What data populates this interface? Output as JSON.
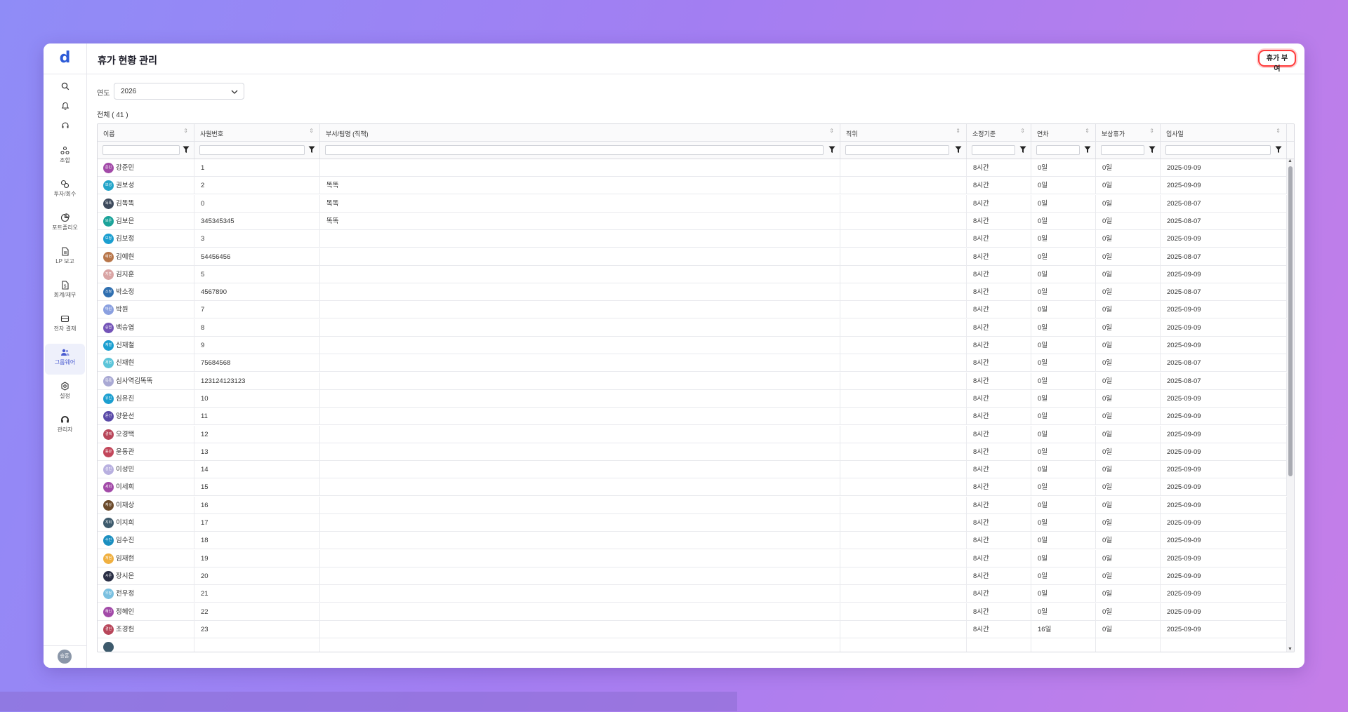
{
  "app": {
    "logo_text": "d"
  },
  "sidebar": {
    "icons": [
      "search-icon",
      "bell-icon",
      "headset-icon"
    ],
    "items": [
      {
        "label": "조합",
        "icon": "union-icon"
      },
      {
        "label": "투자/회수",
        "icon": "investment-icon"
      },
      {
        "label": "포트폴리오",
        "icon": "portfolio-icon"
      },
      {
        "label": "LP 보고",
        "icon": "report-icon"
      },
      {
        "label": "회계/재무",
        "icon": "accounting-icon"
      },
      {
        "label": "전자 결재",
        "icon": "approval-icon"
      },
      {
        "label": "그룹웨어",
        "icon": "groupware-icon",
        "active": true
      },
      {
        "label": "설정",
        "icon": "settings-icon"
      },
      {
        "label": "관리자",
        "icon": "admin-icon"
      }
    ],
    "user_avatar": "승훈"
  },
  "header": {
    "title": "휴가 현황 관리",
    "grant_button": "휴가 부여"
  },
  "filters": {
    "year_label": "연도",
    "year_value": "2026"
  },
  "total": "전체 ( 41 )",
  "table": {
    "columns": [
      "이름",
      "사원번호",
      "부서/팀명 (직책)",
      "직위",
      "소정기준",
      "연차",
      "보상휴가",
      "입사일"
    ],
    "rows": [
      {
        "name": "강준민",
        "avatar": "준민",
        "color": "#a24aa8",
        "no": "1",
        "dept": "",
        "pos": "",
        "base": "8시간",
        "annual": "0일",
        "comp": "0일",
        "join": "2025-09-09"
      },
      {
        "name": "권보성",
        "avatar": "보성",
        "color": "#23a5c9",
        "no": "2",
        "dept": "똑똑",
        "pos": "",
        "base": "8시간",
        "annual": "0일",
        "comp": "0일",
        "join": "2025-09-09"
      },
      {
        "name": "김똑똑",
        "avatar": "똑똑",
        "color": "#3d4a5c",
        "no": "0",
        "dept": "똑똑",
        "pos": "",
        "base": "8시간",
        "annual": "0일",
        "comp": "0일",
        "join": "2025-08-07"
      },
      {
        "name": "김보은",
        "avatar": "보은",
        "color": "#1ba39a",
        "no": "345345345",
        "dept": "똑똑",
        "pos": "",
        "base": "8시간",
        "annual": "0일",
        "comp": "0일",
        "join": "2025-08-07"
      },
      {
        "name": "김보정",
        "avatar": "보정",
        "color": "#1b9fd0",
        "no": "3",
        "dept": "",
        "pos": "",
        "base": "8시간",
        "annual": "0일",
        "comp": "0일",
        "join": "2025-09-09"
      },
      {
        "name": "김예현",
        "avatar": "예현",
        "color": "#b8764a",
        "no": "54456456",
        "dept": "",
        "pos": "",
        "base": "8시간",
        "annual": "0일",
        "comp": "0일",
        "join": "2025-08-07"
      },
      {
        "name": "김지훈",
        "avatar": "지훈",
        "color": "#d9a4a4",
        "no": "5",
        "dept": "",
        "pos": "",
        "base": "8시간",
        "annual": "0일",
        "comp": "0일",
        "join": "2025-09-09"
      },
      {
        "name": "박소정",
        "avatar": "소정",
        "color": "#2f6fb0",
        "no": "4567890",
        "dept": "",
        "pos": "",
        "base": "8시간",
        "annual": "0일",
        "comp": "0일",
        "join": "2025-08-07"
      },
      {
        "name": "박원",
        "avatar": "박원",
        "color": "#8aa0e0",
        "no": "7",
        "dept": "",
        "pos": "",
        "base": "8시간",
        "annual": "0일",
        "comp": "0일",
        "join": "2025-09-09"
      },
      {
        "name": "백승엽",
        "avatar": "승엽",
        "color": "#7454b8",
        "no": "8",
        "dept": "",
        "pos": "",
        "base": "8시간",
        "annual": "0일",
        "comp": "0일",
        "join": "2025-09-09"
      },
      {
        "name": "신재철",
        "avatar": "재철",
        "color": "#1b9fd0",
        "no": "9",
        "dept": "",
        "pos": "",
        "base": "8시간",
        "annual": "0일",
        "comp": "0일",
        "join": "2025-09-09"
      },
      {
        "name": "신재현",
        "avatar": "재현",
        "color": "#5cc5d9",
        "no": "75684568",
        "dept": "",
        "pos": "",
        "base": "8시간",
        "annual": "0일",
        "comp": "0일",
        "join": "2025-08-07"
      },
      {
        "name": "심사역김똑똑",
        "avatar": "똑똑",
        "color": "#a9a9d4",
        "no": "123124123123",
        "dept": "",
        "pos": "",
        "base": "8시간",
        "annual": "0일",
        "comp": "0일",
        "join": "2025-08-07"
      },
      {
        "name": "심유진",
        "avatar": "유진",
        "color": "#1b9fd0",
        "no": "10",
        "dept": "",
        "pos": "",
        "base": "8시간",
        "annual": "0일",
        "comp": "0일",
        "join": "2025-09-09"
      },
      {
        "name": "양윤선",
        "avatar": "윤선",
        "color": "#5a4aa8",
        "no": "11",
        "dept": "",
        "pos": "",
        "base": "8시간",
        "annual": "0일",
        "comp": "0일",
        "join": "2025-09-09"
      },
      {
        "name": "오경택",
        "avatar": "경택",
        "color": "#b8465a",
        "no": "12",
        "dept": "",
        "pos": "",
        "base": "8시간",
        "annual": "0일",
        "comp": "0일",
        "join": "2025-09-09"
      },
      {
        "name": "윤동관",
        "avatar": "동관",
        "color": "#c2465a",
        "no": "13",
        "dept": "",
        "pos": "",
        "base": "8시간",
        "annual": "0일",
        "comp": "0일",
        "join": "2025-09-09"
      },
      {
        "name": "이성민",
        "avatar": "성민",
        "color": "#b8b0e0",
        "no": "14",
        "dept": "",
        "pos": "",
        "base": "8시간",
        "annual": "0일",
        "comp": "0일",
        "join": "2025-09-09"
      },
      {
        "name": "이세희",
        "avatar": "세희",
        "color": "#a24aa8",
        "no": "15",
        "dept": "",
        "pos": "",
        "base": "8시간",
        "annual": "0일",
        "comp": "0일",
        "join": "2025-09-09"
      },
      {
        "name": "이재상",
        "avatar": "재상",
        "color": "#6b4a2a",
        "no": "16",
        "dept": "",
        "pos": "",
        "base": "8시간",
        "annual": "0일",
        "comp": "0일",
        "join": "2025-09-09"
      },
      {
        "name": "이지희",
        "avatar": "지희",
        "color": "#3d5a6c",
        "no": "17",
        "dept": "",
        "pos": "",
        "base": "8시간",
        "annual": "0일",
        "comp": "0일",
        "join": "2025-09-09"
      },
      {
        "name": "임수진",
        "avatar": "수진",
        "color": "#1b8fc0",
        "no": "18",
        "dept": "",
        "pos": "",
        "base": "8시간",
        "annual": "0일",
        "comp": "0일",
        "join": "2025-09-09"
      },
      {
        "name": "임재현",
        "avatar": "재현",
        "color": "#f0b040",
        "no": "19",
        "dept": "",
        "pos": "",
        "base": "8시간",
        "annual": "0일",
        "comp": "0일",
        "join": "2025-09-09"
      },
      {
        "name": "장시온",
        "avatar": "시온",
        "color": "#2a2f45",
        "no": "20",
        "dept": "",
        "pos": "",
        "base": "8시간",
        "annual": "0일",
        "comp": "0일",
        "join": "2025-09-09"
      },
      {
        "name": "전우정",
        "avatar": "우정",
        "color": "#7ac0e0",
        "no": "21",
        "dept": "",
        "pos": "",
        "base": "8시간",
        "annual": "0일",
        "comp": "0일",
        "join": "2025-09-09"
      },
      {
        "name": "정혜인",
        "avatar": "혜인",
        "color": "#a24aa8",
        "no": "22",
        "dept": "",
        "pos": "",
        "base": "8시간",
        "annual": "0일",
        "comp": "0일",
        "join": "2025-09-09"
      },
      {
        "name": "조경헌",
        "avatar": "경헌",
        "color": "#b8465a",
        "no": "23",
        "dept": "",
        "pos": "",
        "base": "8시간",
        "annual": "16일",
        "comp": "0일",
        "join": "2025-09-09"
      },
      {
        "name": "",
        "avatar": "",
        "color": "#3d5a6c",
        "no": "",
        "dept": "",
        "pos": "",
        "base": "",
        "annual": "",
        "comp": "",
        "join": ""
      }
    ]
  }
}
